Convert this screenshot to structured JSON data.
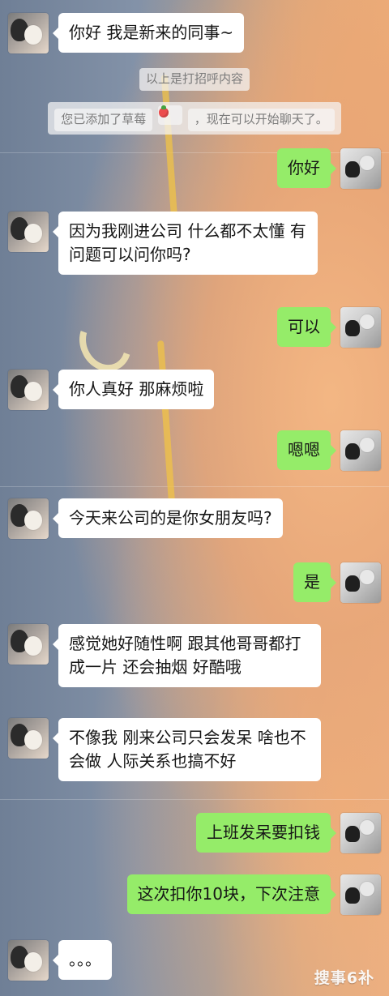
{
  "chat": {
    "messages": [
      {
        "id": "m1",
        "side": "left",
        "text": "你好 我是新来的同事~"
      },
      {
        "id": "m2",
        "side": "right",
        "text": "你好"
      },
      {
        "id": "m3",
        "side": "left",
        "text": "因为我刚进公司 什么都不太懂 有问题可以问你吗?"
      },
      {
        "id": "m4",
        "side": "right",
        "text": "可以"
      },
      {
        "id": "m5",
        "side": "left",
        "text": "你人真好 那麻烦啦"
      },
      {
        "id": "m6",
        "side": "right",
        "text": "嗯嗯"
      },
      {
        "id": "m7",
        "side": "left",
        "text": "今天来公司的是你女朋友吗?"
      },
      {
        "id": "m8",
        "side": "right",
        "text": "是"
      },
      {
        "id": "m9",
        "side": "left",
        "text": "感觉她好随性啊 跟其他哥哥都打成一片 还会抽烟 好酷哦"
      },
      {
        "id": "m10",
        "side": "left",
        "text": "不像我 刚来公司只会发呆 啥也不会做 人际关系也搞不好"
      },
      {
        "id": "m11",
        "side": "right",
        "text": "上班发呆要扣钱"
      },
      {
        "id": "m12",
        "side": "right",
        "text": "这次扣你10块，下次注意"
      },
      {
        "id": "m13",
        "side": "left",
        "text": "。。。"
      }
    ],
    "system": {
      "greeting_note": "以上是打招呼内容",
      "added_prefix": "您已添加了草莓",
      "added_suffix": "，现在可以开始聊天了。"
    }
  },
  "watermark": {
    "text": "搜事6补"
  }
}
